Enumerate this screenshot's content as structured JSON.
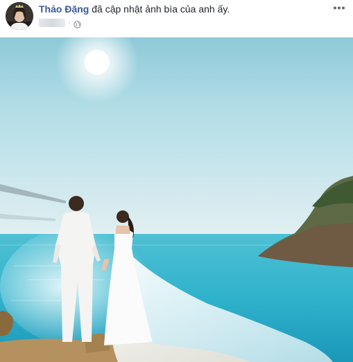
{
  "post": {
    "author_name": "Thảo Đặng",
    "action_text": "đã cập nhật ảnh bìa của anh ấy.",
    "separator": "·",
    "privacy_icon": "globe-icon",
    "more_icon": "more-dots-icon"
  },
  "photo": {
    "subject": "couple-by-sea-photo"
  },
  "colors": {
    "author_link": "#385898",
    "text": "#1d2129",
    "meta": "#90949c"
  }
}
